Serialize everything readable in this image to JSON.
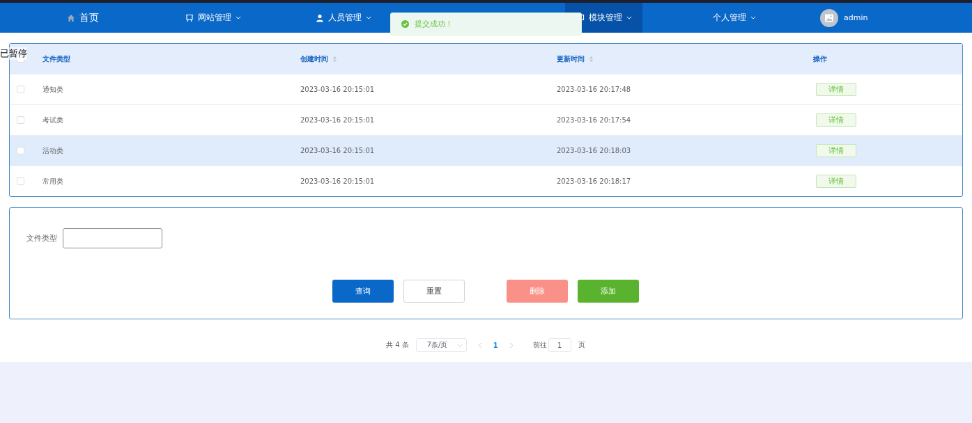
{
  "overlay_label": "已暂停",
  "nav": {
    "items": [
      {
        "label": "首页",
        "dropdown": false,
        "selected": false
      },
      {
        "label": "网站管理",
        "dropdown": true,
        "selected": false
      },
      {
        "label": "人员管理",
        "dropdown": true,
        "selected": false
      },
      {
        "label": "模块管理",
        "dropdown": true,
        "selected": true
      },
      {
        "label": "个人管理",
        "dropdown": true,
        "selected": false
      }
    ],
    "user": "admin"
  },
  "toast": {
    "message": "提交成功！"
  },
  "table": {
    "header_checked": false,
    "columns": [
      {
        "label": "文件类型",
        "sortable": false
      },
      {
        "label": "创建时间",
        "sortable": true
      },
      {
        "label": "更新时间",
        "sortable": true
      },
      {
        "label": "操作",
        "sortable": false
      }
    ],
    "rows": [
      {
        "checked": false,
        "hovered": false,
        "cells": [
          "通知类",
          "2023-03-16 20:15:01",
          "2023-03-16 20:17:48"
        ],
        "action": "详情"
      },
      {
        "checked": false,
        "hovered": false,
        "cells": [
          "考试类",
          "2023-03-16 20:15:01",
          "2023-03-16 20:17:54"
        ],
        "action": "详情"
      },
      {
        "checked": false,
        "hovered": true,
        "cells": [
          "活动类",
          "2023-03-16 20:15:01",
          "2023-03-16 20:18:03"
        ],
        "action": "详情"
      },
      {
        "checked": false,
        "hovered": false,
        "cells": [
          "常用类",
          "2023-03-16 20:15:01",
          "2023-03-16 20:18:17"
        ],
        "action": "详情"
      }
    ]
  },
  "search": {
    "label": "文件类型",
    "buttons": [
      {
        "label": "查询",
        "kind": "primary"
      },
      {
        "label": "重置",
        "kind": "plain"
      },
      {
        "label": "删除",
        "kind": "danger"
      },
      {
        "label": "添加",
        "kind": "success"
      }
    ]
  },
  "pagination": {
    "total": "共 4 条",
    "page_size": "7条/页",
    "pages": [
      {
        "label": "1",
        "selected": true
      }
    ],
    "goto_label": "前往",
    "goto_value": "1",
    "goto_suffix": "页"
  }
}
